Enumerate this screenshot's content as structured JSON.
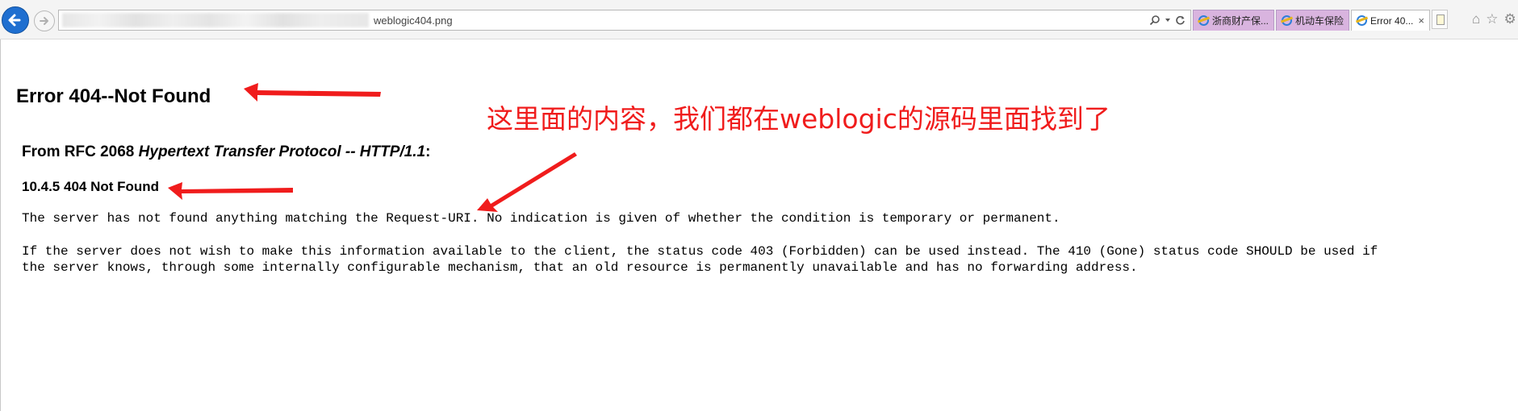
{
  "browser": {
    "address_text": "weblogic404.png",
    "tabs": [
      {
        "label": "浙商财产保...",
        "active": false
      },
      {
        "label": "机动车保险",
        "active": false
      },
      {
        "label": "Error 40...",
        "active": true
      }
    ],
    "tab_close": "×"
  },
  "page": {
    "title": "Error 404--Not Found",
    "rfc_prefix": "From RFC 2068 ",
    "rfc_italic": "Hypertext Transfer Protocol -- HTTP/1.1",
    "rfc_suffix": ":",
    "section_heading": "10.4.5 404 Not Found",
    "paragraph1": "The server has not found anything matching the Request-URI. No indication is given of whether the condition is temporary or permanent.",
    "paragraph2_line1": "If the server does not wish to make this information available to the client, the status code 403 (Forbidden) can be used instead. The 410 (Gone) status code SHOULD be used if",
    "paragraph2_line2": "the server knows, through some internally configurable mechanism, that an old resource is permanently unavailable and has no forwarding address."
  },
  "annotation": {
    "note": "这里面的内容，我们都在weblogic的源码里面找到了",
    "color": "#f01c1c"
  },
  "icons": [
    "back-arrow-icon",
    "forward-arrow-icon",
    "search-icon",
    "dropdown-icon",
    "refresh-icon",
    "ie-favicon-icon",
    "new-tab-icon",
    "home-icon",
    "star-icon",
    "gear-icon"
  ]
}
